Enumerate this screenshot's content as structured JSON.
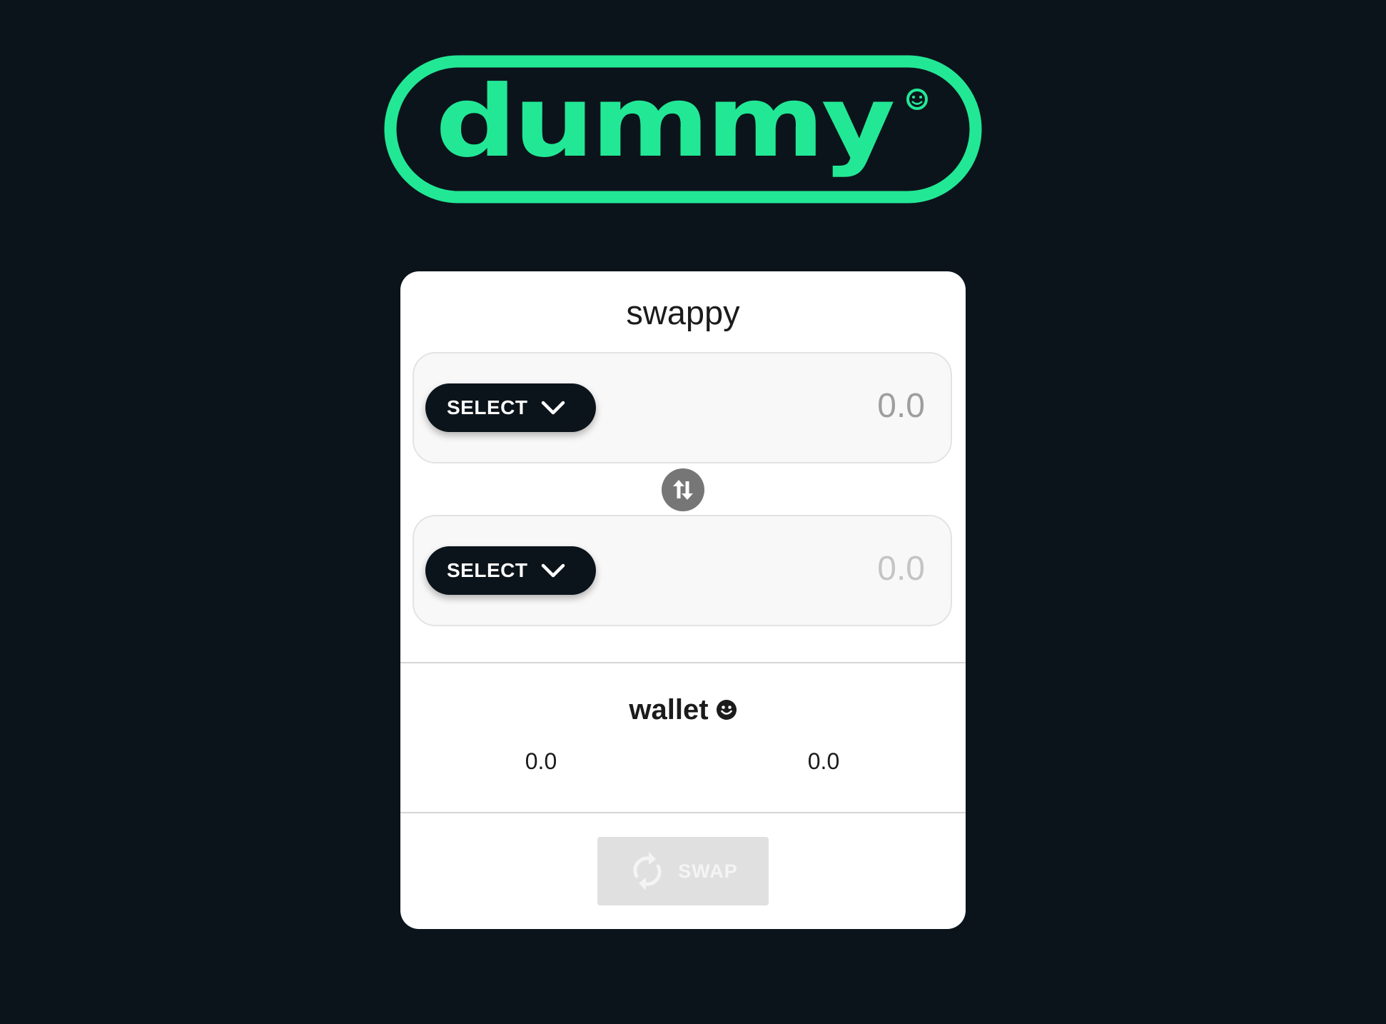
{
  "brand": {
    "logo_text": "dummy",
    "accent_color": "#22e896",
    "background_color": "#0c141b"
  },
  "swap_card": {
    "title": "swappy",
    "from_token": {
      "select_label": "SELECT",
      "amount_placeholder": "0.0"
    },
    "to_token": {
      "select_label": "SELECT",
      "amount_placeholder": "0.0"
    },
    "switch_icon": "arrows-up-down-icon",
    "wallet": {
      "title": "wallet",
      "title_icon": "smile-icon",
      "balance_from": "0.0",
      "balance_to": "0.0"
    },
    "swap_button": {
      "label": "SWAP",
      "icon": "sync-icon",
      "disabled": true
    }
  }
}
